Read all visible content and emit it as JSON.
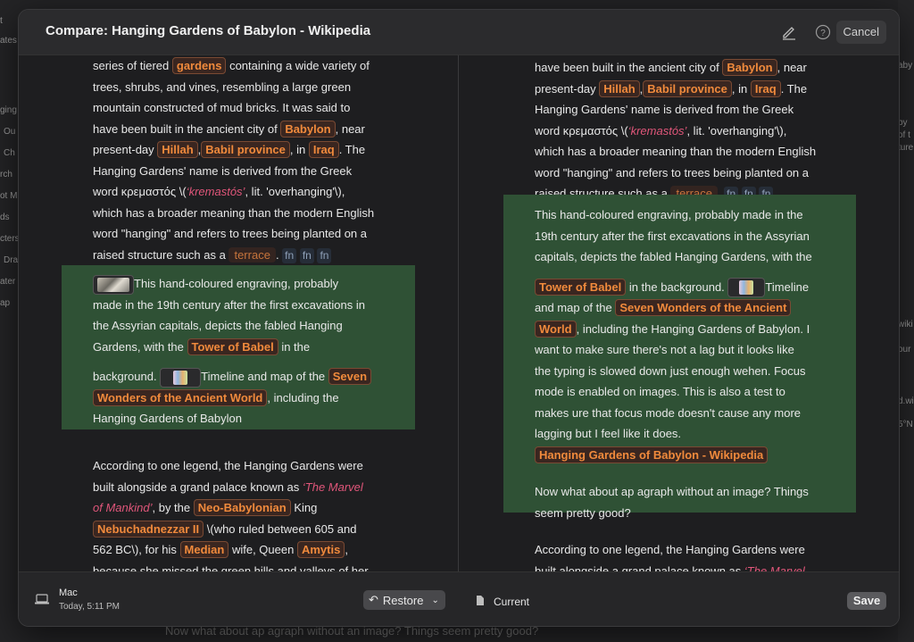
{
  "background": {
    "side_labels": [
      "t",
      "ates",
      "ging",
      "Ou",
      "Ch",
      "rch",
      "ot M",
      "ds",
      "cters",
      "Dra",
      "ater",
      "ap"
    ],
    "right_labels": [
      "aby",
      "by",
      "of t",
      "ture",
      "wiki",
      "our",
      "d.wi",
      "5°N"
    ],
    "bottom_text": "Now what about ap agraph without an image? Things seem pretty good?"
  },
  "modal": {
    "title": "Compare: Hanging Gardens of Babylon - Wikipedia",
    "cancel_label": "Cancel"
  },
  "left": {
    "p1": {
      "l1a": "series of tiered ",
      "t_gardens": "gardens",
      "l1b": " containing a wide variety of",
      "l2": "trees, shrubs, and vines, resembling a large green",
      "l3": "mountain constructed of mud bricks. It was said to",
      "l4a": "have been built in the ancient city of ",
      "t_babylon": "Babylon",
      "l4b": ", near",
      "l5a": "present-day ",
      "t_hillah": "Hillah",
      ",": ",",
      "t_babil": "Babil province",
      "l5b": ", in ",
      "t_iraq": "Iraq",
      "l5c": ". The",
      "l6": "Hanging Gardens' name is derived from the Greek",
      "l7a": "word κρεμαστός \\(",
      "t_krem": "‘kremastós’",
      "l7b": ", lit. 'overhanging'\\),",
      "l8": "which has a broader meaning than the modern English",
      "l9": "word \"hanging\" and refers to trees being planted on a",
      "l10a": "raised structure such as a ",
      "t_terrace": "terrace",
      "l10b": ". ",
      "fn": "fn"
    },
    "p2": {
      "l1": "This hand-coloured engraving, probably",
      "l2": "made in the 19th century after the first excavations in",
      "l3": "the Assyrian capitals, depicts the fabled Hanging",
      "l4a": "Gardens, with the ",
      "t_tower": "Tower of Babel",
      "l4b": " in the",
      "l5a": "background. ",
      "l5b": "Timeline and map of the ",
      "t_seven": "Seven",
      "t_wonders": "Wonders of the Ancient World",
      "l6b": ", including the",
      "l7": "Hanging Gardens of Babylon"
    },
    "p3": {
      "l1": "According to one legend, the Hanging Gardens were",
      "l2a": "built alongside a grand palace known as ",
      "t_marvel1": "‘The Marvel",
      "t_marvel2": "of Mankind’",
      "l3a": ", by the ",
      "t_neo": "Neo-Babylonian",
      "l3b": " King",
      "t_neb": "Nebuchadnezzar II",
      "l4b": " \\(who ruled between 605 and",
      "l5a": "562 BC\\), for his ",
      "t_median": "Median",
      "l5b": " wife, Queen ",
      "t_amytis": "Amytis",
      ",": ",",
      "l6": "because she missed the green hills and valleys of her"
    }
  },
  "right": {
    "p1": {
      "l1a": "have been built in the ancient city of ",
      "t_babylon": "Babylon",
      "l1b": ", near",
      "l2a": "present-day ",
      "t_hillah": "Hillah",
      ",": ",",
      "t_babil": "Babil province",
      "l2b": ", in ",
      "t_iraq": "Iraq",
      "l2c": ". The",
      "l3": "Hanging Gardens' name is derived from the Greek",
      "l4a": "word κρεμαστός \\(",
      "t_krem": "‘kremastós’",
      "l4b": ", lit. 'overhanging'\\),",
      "l5": "which has a broader meaning than the modern English",
      "l6": "word \"hanging\" and refers to trees being planted on a",
      "l7a": "raised structure such as a ",
      "t_terrace": "terrace",
      "l7b": ". ",
      "fn": "fn"
    },
    "p2": {
      "l1": "This hand-coloured engraving, probably made in the",
      "l2": "19th century after the first excavations in the Assyrian",
      "l3": "capitals, depicts the fabled Hanging Gardens, with the",
      "t_tower": "Tower of Babel",
      "l4b": " in the background. ",
      "l4c": "Timeline",
      "l5a": "and map of the ",
      "t_seven": "Seven Wonders of the Ancient",
      "t_world": "World",
      "l6b": ", including the Hanging Gardens of Babylon. I",
      "l7": "want to make sure there's not a lag but it looks like",
      "l8": "the typing is slowed down just enough wehen. Focus",
      "l9": "mode is enabled on images. This is also a test to",
      "l10": "makes ure that focus mode doesn't cause any more",
      "l11": "lagging but I feel like it does.",
      "t_hg": "Hanging Gardens of Babylon - Wikipedia",
      "l13": "Now what about ap agraph without an image? Things",
      "l14": "seem pretty good?"
    },
    "p3": {
      "l1": "According to one legend, the Hanging Gardens were",
      "l2a": "built alongside a grand palace known as ",
      "t_marvel": "‘The Marvel"
    }
  },
  "footer": {
    "left_device": "Mac",
    "left_time": "Today, 5:11 PM",
    "restore_label": "Restore",
    "right_label": "Current",
    "save_label": "Save"
  },
  "colors": {
    "highlight": "#2f5135",
    "link": "#f08a3c",
    "italic": "#e0567a"
  }
}
